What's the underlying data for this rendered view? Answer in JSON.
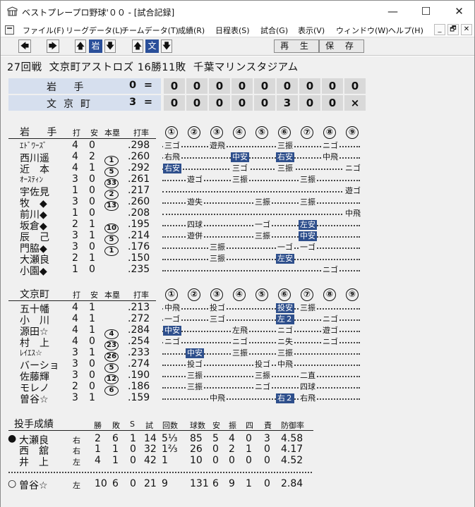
{
  "window": {
    "title": "ベストプレープロ野球'００ - [試合記録]",
    "minimize": "—",
    "maximize": "☐",
    "close": "✕"
  },
  "menu": [
    "ファイル(F)",
    "リーグデータ(L)",
    "チームデータ(T)",
    "成績(R)",
    "日程表(S)",
    "試合(G)",
    "表示(V)",
    "ウィンドウ(W)",
    "ヘルプ(H)"
  ],
  "mdi": [
    "_",
    "🗗",
    "✕"
  ],
  "toolbar": {
    "prev": "🡄",
    "next": "🡆",
    "up1": "🡅",
    "team1": "岩",
    "down1": "🡇",
    "up2": "🡅",
    "team2": "文",
    "down2": "🡇",
    "play": "再 生",
    "save": "保 存"
  },
  "header": {
    "game": "27回戦",
    "team": "文京町アストロズ",
    "record": "16勝11敗",
    "stadium": "千葉マリンスタジアム"
  },
  "scoreboard": [
    {
      "team": "岩 手",
      "total": "0",
      "eq": "=",
      "innings": [
        "0",
        "0",
        "0",
        "0",
        "0",
        "0",
        "0",
        "0",
        "0"
      ]
    },
    {
      "team": "文京町",
      "total": "3",
      "eq": "=",
      "innings": [
        "0",
        "0",
        "0",
        "0",
        "0",
        "3",
        "0",
        "0",
        "×"
      ]
    }
  ],
  "colors": {
    "accent": "#2e4f8c",
    "band": "#d6dfee"
  },
  "headers": {
    "ab": "打",
    "h": "安",
    "hr": "本塁",
    "avg": "打率",
    "innings": [
      "①",
      "②",
      "③",
      "④",
      "⑤",
      "⑥",
      "⑦",
      "⑧",
      "⑨"
    ]
  },
  "team1": {
    "name": "岩 手",
    "players": [
      {
        "name": "ｴﾄﾞﾜｰｽﾞ",
        "ab": "4",
        "h": "0",
        "hr": "",
        "avg": ".298",
        "res": [
          [
            "1",
            "三ゴ",
            0
          ],
          [
            "3",
            "遊飛",
            0
          ],
          [
            "6",
            "三振",
            0
          ],
          [
            "8",
            "ニゴ",
            0
          ]
        ]
      },
      {
        "name": "西川遥",
        "ab": "4",
        "h": "2",
        "hr": "1",
        "avg": ".260",
        "res": [
          [
            "1",
            "右飛",
            0
          ],
          [
            "4",
            "中安",
            1
          ],
          [
            "6",
            "右安",
            1
          ],
          [
            "8",
            "中飛",
            0
          ]
        ]
      },
      {
        "name": "近　本",
        "ab": "4",
        "h": "1",
        "hr": "5",
        "avg": ".292",
        "res": [
          [
            "1",
            "右安",
            1
          ],
          [
            "4",
            "三ゴ",
            0
          ],
          [
            "6",
            "三振",
            0
          ],
          [
            "9",
            "ニゴ",
            0
          ]
        ]
      },
      {
        "name": "ｵｰｽﾃｨﾝ",
        "ab": "3",
        "h": "0",
        "hr": "33",
        "avg": ".261",
        "res": [
          [
            "2",
            "遊ゴ",
            0
          ],
          [
            "4",
            "三振",
            0
          ],
          [
            "7",
            "三振",
            0
          ]
        ]
      },
      {
        "name": "宇佐見",
        "ab": "1",
        "h": "0",
        "hr": "2",
        "avg": ".217",
        "res": [
          [
            "9",
            "遊ゴ",
            0
          ]
        ]
      },
      {
        "name": "牧　◆",
        "ab": "3",
        "h": "0",
        "hr": "13",
        "avg": ".260",
        "res": [
          [
            "2",
            "遊失",
            0
          ],
          [
            "5",
            "三振",
            0
          ],
          [
            "7",
            "三振",
            0
          ]
        ]
      },
      {
        "name": "前川◆",
        "ab": "1",
        "h": "0",
        "hr": "",
        "avg": ".208",
        "res": [
          [
            "9",
            "中飛",
            0
          ]
        ]
      },
      {
        "name": "坂倉◆",
        "ab": "2",
        "h": "1",
        "hr": "10",
        "avg": ".195",
        "res": [
          [
            "2",
            "四球",
            0
          ],
          [
            "5",
            "一ゴ",
            0
          ],
          [
            "7",
            "左安",
            1
          ]
        ]
      },
      {
        "name": "辰　己",
        "ab": "3",
        "h": "1",
        "hr": "5",
        "avg": ".214",
        "res": [
          [
            "2",
            "遊併",
            0
          ],
          [
            "5",
            "三振",
            0
          ],
          [
            "7",
            "中安",
            1
          ]
        ]
      },
      {
        "name": "門脇◆",
        "ab": "3",
        "h": "0",
        "hr": "1",
        "avg": ".176",
        "res": [
          [
            "3",
            "三振",
            0
          ],
          [
            "6",
            "一ゴ",
            0
          ],
          [
            "7",
            "一ゴ",
            0
          ]
        ]
      },
      {
        "name": "大瀬良",
        "ab": "2",
        "h": "1",
        "hr": "",
        "avg": ".150",
        "res": [
          [
            "3",
            "三振",
            0
          ],
          [
            "6",
            "左安",
            1
          ]
        ]
      },
      {
        "name": "小園◆",
        "ab": "1",
        "h": "0",
        "hr": "",
        "avg": ".235",
        "res": [
          [
            "8",
            "ニゴ",
            0
          ]
        ]
      }
    ]
  },
  "team2": {
    "name": "文京町",
    "players": [
      {
        "name": "五十幡",
        "ab": "4",
        "h": "1",
        "hr": "",
        "avg": ".213",
        "res": [
          [
            "1",
            "中飛",
            0
          ],
          [
            "3",
            "投ゴ",
            0
          ],
          [
            "6",
            "投安",
            1
          ],
          [
            "7",
            "三振",
            0
          ]
        ]
      },
      {
        "name": "小　川",
        "ab": "4",
        "h": "1",
        "hr": "",
        "avg": ".272",
        "res": [
          [
            "1",
            "一ゴ",
            0
          ],
          [
            "3",
            "三ゴ",
            0
          ],
          [
            "6",
            "左２",
            1
          ],
          [
            "8",
            "ニゴ",
            0
          ]
        ]
      },
      {
        "name": "源田☆",
        "ab": "4",
        "h": "1",
        "hr": "4",
        "avg": ".284",
        "res": [
          [
            "1",
            "中安",
            1
          ],
          [
            "4",
            "左飛",
            0
          ],
          [
            "6",
            "ニゴ",
            0
          ],
          [
            "8",
            "遊ゴ",
            0
          ]
        ]
      },
      {
        "name": "村　上",
        "ab": "4",
        "h": "0",
        "hr": "23",
        "avg": ".254",
        "res": [
          [
            "1",
            "ニゴ",
            0
          ],
          [
            "4",
            "ニゴ",
            0
          ],
          [
            "6",
            "ニ失",
            0
          ],
          [
            "8",
            "ニゴ",
            0
          ]
        ]
      },
      {
        "name": "ﾚｲｴｽ☆",
        "ab": "3",
        "h": "1",
        "hr": "26",
        "avg": ".233",
        "res": [
          [
            "2",
            "中安",
            1
          ],
          [
            "4",
            "三振",
            0
          ],
          [
            "6",
            "三振",
            0
          ]
        ]
      },
      {
        "name": "バーショ",
        "ab": "3",
        "h": "0",
        "hr": "5",
        "avg": ".274",
        "res": [
          [
            "2",
            "投ゴ",
            0
          ],
          [
            "5",
            "投ゴ",
            0
          ],
          [
            "6",
            "中飛",
            0
          ]
        ]
      },
      {
        "name": "佐藤輝",
        "ab": "3",
        "h": "0",
        "hr": "12",
        "avg": ".190",
        "res": [
          [
            "2",
            "三振",
            0
          ],
          [
            "5",
            "三振",
            0
          ],
          [
            "7",
            "二直",
            0
          ]
        ]
      },
      {
        "name": "モレノ",
        "ab": "2",
        "h": "0",
        "hr": "6",
        "avg": ".186",
        "res": [
          [
            "2",
            "三振",
            0
          ],
          [
            "5",
            "ニゴ",
            0
          ],
          [
            "7",
            "四球",
            0
          ]
        ]
      },
      {
        "name": "曽谷☆",
        "ab": "3",
        "h": "1",
        "hr": "",
        "avg": ".159",
        "res": [
          [
            "3",
            "中飛",
            0
          ],
          [
            "6",
            "右２",
            1
          ],
          [
            "7",
            "右飛",
            0
          ]
        ]
      }
    ]
  },
  "pitching": {
    "title": "投手成績",
    "headers": [
      "勝",
      "敗",
      "S",
      "試",
      "回数",
      "球数",
      "安",
      "振",
      "四",
      "責",
      "防御率"
    ],
    "rows": [
      {
        "mark": "●",
        "name": "大瀬良",
        "hand": "右",
        "w": "2",
        "l": "6",
        "s": "1",
        "g": "14",
        "ip": "5⅓",
        "np": "85",
        "h": "5",
        "k": "4",
        "bb": "0",
        "er": "3",
        "era": "4.58"
      },
      {
        "mark": "",
        "name": "西　舘",
        "hand": "右",
        "w": "1",
        "l": "1",
        "s": "0",
        "g": "32",
        "ip": "1⅔",
        "np": "26",
        "h": "0",
        "k": "2",
        "bb": "1",
        "er": "0",
        "era": "4.17"
      },
      {
        "mark": "",
        "name": "井　上",
        "hand": "左",
        "w": "4",
        "l": "1",
        "s": "0",
        "g": "42",
        "ip": "1",
        "np": "10",
        "h": "0",
        "k": "0",
        "bb": "0",
        "er": "0",
        "era": "4.52"
      },
      {
        "mark": "○",
        "name": "曽谷☆",
        "hand": "左",
        "w": "10",
        "l": "6",
        "s": "0",
        "g": "21",
        "ip": "9",
        "np": "131",
        "h": "6",
        "k": "9",
        "bb": "1",
        "er": "0",
        "era": "2.84"
      }
    ]
  }
}
